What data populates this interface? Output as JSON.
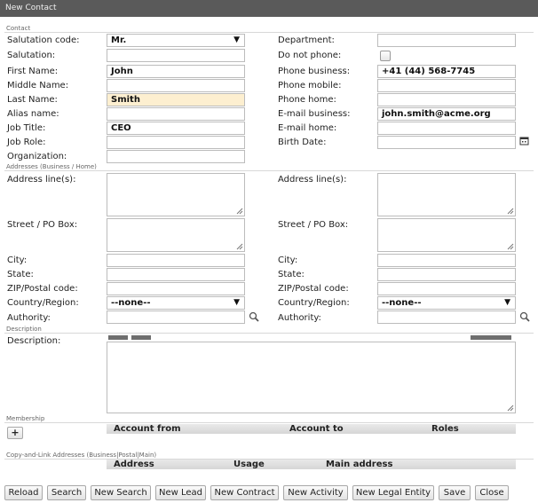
{
  "window": {
    "title": "New Contact"
  },
  "sections": {
    "contact": "Contact",
    "addresses": "Addresses (Business / Home)",
    "description": "Description",
    "membership": "Membership",
    "copylink": "Copy-and-Link Addresses (Business|Postal|Main)"
  },
  "contact": {
    "salutation_code": {
      "label": "Salutation code:",
      "value": "Mr."
    },
    "salutation": {
      "label": "Salutation:",
      "value": ""
    },
    "first_name": {
      "label": "First Name:",
      "value": "John"
    },
    "middle_name": {
      "label": "Middle Name:",
      "value": ""
    },
    "last_name": {
      "label": "Last Name:",
      "value": "Smith"
    },
    "alias_name": {
      "label": "Alias name:",
      "value": ""
    },
    "job_title": {
      "label": "Job Title:",
      "value": "CEO"
    },
    "job_role": {
      "label": "Job Role:",
      "value": ""
    },
    "organization": {
      "label": "Organization:",
      "value": ""
    },
    "department": {
      "label": "Department:",
      "value": ""
    },
    "do_not_phone": {
      "label": "Do not phone:",
      "checked": false
    },
    "phone_business": {
      "label": "Phone business:",
      "value": "+41 (44) 568-7745"
    },
    "phone_mobile": {
      "label": "Phone mobile:",
      "value": ""
    },
    "phone_home": {
      "label": "Phone home:",
      "value": ""
    },
    "email_business": {
      "label": "E-mail business:",
      "value": "john.smith@acme.org"
    },
    "email_home": {
      "label": "E-mail home:",
      "value": ""
    },
    "birth_date": {
      "label": "Birth Date:",
      "value": ""
    }
  },
  "addresses": {
    "business": {
      "address_lines": {
        "label": "Address line(s):",
        "value": ""
      },
      "street": {
        "label": "Street / PO Box:",
        "value": ""
      },
      "city": {
        "label": "City:",
        "value": ""
      },
      "state": {
        "label": "State:",
        "value": ""
      },
      "zip": {
        "label": "ZIP/Postal code:",
        "value": ""
      },
      "country": {
        "label": "Country/Region:",
        "value": "--none--"
      },
      "authority": {
        "label": "Authority:",
        "value": ""
      }
    },
    "home": {
      "address_lines": {
        "label": "Address line(s):",
        "value": ""
      },
      "street": {
        "label": "Street / PO Box:",
        "value": ""
      },
      "city": {
        "label": "City:",
        "value": ""
      },
      "state": {
        "label": "State:",
        "value": ""
      },
      "zip": {
        "label": "ZIP/Postal code:",
        "value": ""
      },
      "country": {
        "label": "Country/Region:",
        "value": "--none--"
      },
      "authority": {
        "label": "Authority:",
        "value": ""
      }
    }
  },
  "description": {
    "label": "Description:",
    "value": ""
  },
  "membership": {
    "add_label": "+",
    "columns": [
      "Account from",
      "Account to",
      "Roles"
    ]
  },
  "copylink": {
    "columns": [
      "Address",
      "Usage",
      "Main address"
    ]
  },
  "buttons": {
    "reload": "Reload",
    "search": "Search",
    "new_search": "New Search",
    "new_lead": "New Lead",
    "new_contract": "New Contract",
    "new_activity": "New Activity",
    "new_legal_entity": "New Legal Entity",
    "save": "Save",
    "close": "Close"
  },
  "icons": {
    "calendar": "calendar-icon",
    "search": "magnifier-icon",
    "dropdown": "chevron-down-icon"
  },
  "colors": {
    "titlebar": "#5a5a5a",
    "highlight_field": "#fdefd0"
  }
}
